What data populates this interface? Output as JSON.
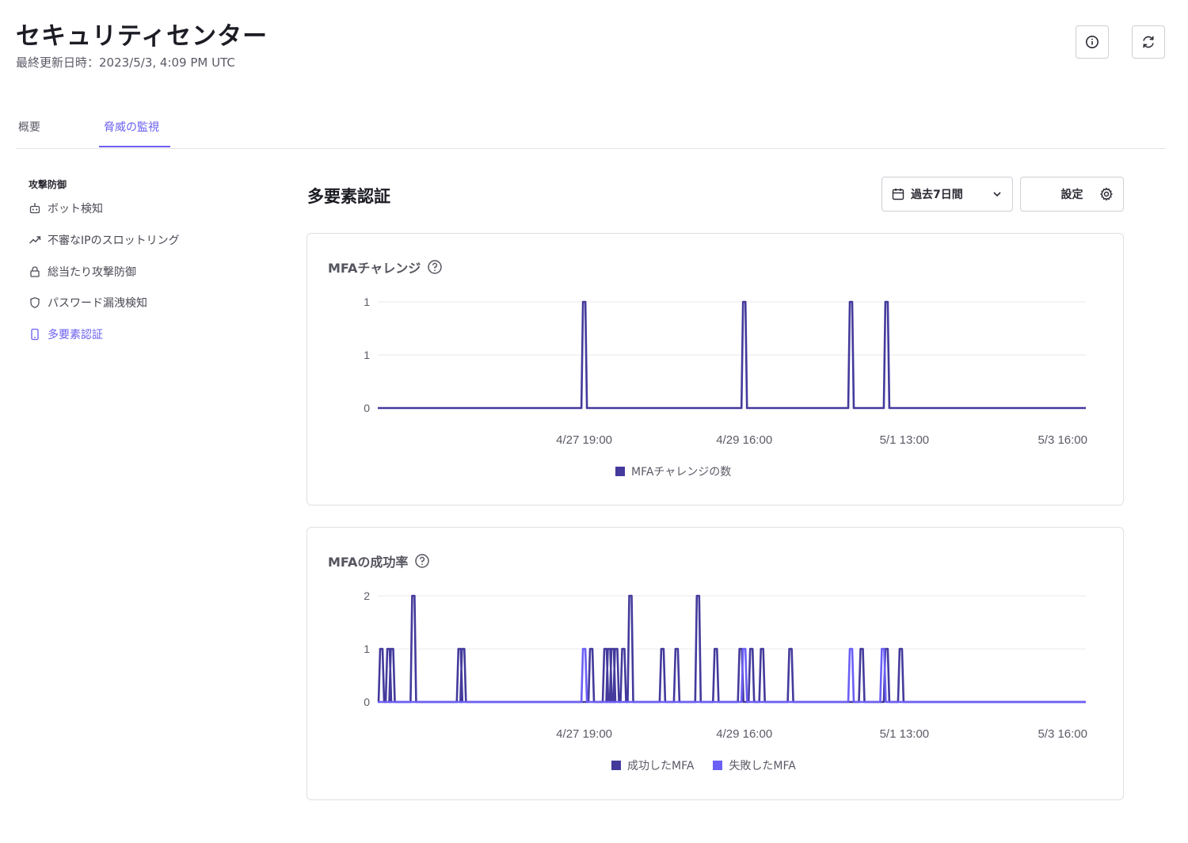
{
  "header": {
    "title": "セキュリティセンター",
    "last_updated": "最終更新日時：2023/5/3, 4:09 PM UTC",
    "info_icon": "info-icon",
    "refresh_icon": "refresh-icon"
  },
  "tabs": [
    {
      "label": "概要",
      "active": false
    },
    {
      "label": "脅威の監視",
      "active": true
    }
  ],
  "sidebar": {
    "section": "攻撃防御",
    "items": [
      {
        "label": "ボット検知",
        "icon": "robot-icon",
        "active": false
      },
      {
        "label": "不審なIPのスロットリング",
        "icon": "trend-icon",
        "active": false
      },
      {
        "label": "総当たり攻撃防御",
        "icon": "lock-icon",
        "active": false
      },
      {
        "label": "パスワード漏洩検知",
        "icon": "shield-icon",
        "active": false
      },
      {
        "label": "多要素認証",
        "icon": "phone-icon",
        "active": true
      }
    ]
  },
  "main": {
    "title": "多要素認証",
    "period": "過去7日間",
    "settings": "設定"
  },
  "colors": {
    "accent": "#6b5ff0",
    "series_dark": "#433a9c",
    "series_light": "#6b5ff6"
  },
  "chart_data": [
    {
      "type": "line",
      "title": "MFAチャレンジ",
      "x_ticks": [
        "4/27 19:00",
        "4/29 16:00",
        "5/1 13:00",
        "5/3 16:00"
      ],
      "y_tick_labels": [
        "1",
        "1",
        "0"
      ],
      "ylim": [
        0,
        1
      ],
      "grid": true,
      "legend_position": "bottom",
      "series": [
        {
          "name": "MFAチャレンジの数",
          "color": "#433a9c",
          "points": [
            [
              "4/27 19:00",
              1
            ],
            [
              "4/29 16:00",
              1
            ],
            [
              "4/30 22:00",
              1
            ],
            [
              "5/1 08:00",
              1
            ]
          ]
        }
      ]
    },
    {
      "type": "line",
      "title": "MFAの成功率",
      "x_ticks": [
        "4/27 19:00",
        "4/29 16:00",
        "5/1 13:00",
        "5/3 16:00"
      ],
      "y_tick_labels": [
        "2",
        "1",
        "0"
      ],
      "ylim": [
        0,
        2
      ],
      "grid": true,
      "legend_position": "bottom",
      "series": [
        {
          "name": "成功したMFA",
          "color": "#433a9c",
          "points": [
            [
              "4/25 10:00",
              1
            ],
            [
              "4/25 12:00",
              1
            ],
            [
              "4/25 13:00",
              1
            ],
            [
              "4/25 19:00",
              2
            ],
            [
              "4/26 08:00",
              1
            ],
            [
              "4/26 09:00",
              1
            ],
            [
              "4/27 21:00",
              1
            ],
            [
              "4/28 01:00",
              1
            ],
            [
              "4/28 02:00",
              1
            ],
            [
              "4/28 03:00",
              1
            ],
            [
              "4/28 04:00",
              1
            ],
            [
              "4/28 06:00",
              1
            ],
            [
              "4/28 08:00",
              2
            ],
            [
              "4/28 17:00",
              1
            ],
            [
              "4/28 21:00",
              1
            ],
            [
              "4/29 03:00",
              2
            ],
            [
              "4/29 08:00",
              1
            ],
            [
              "4/29 15:00",
              1
            ],
            [
              "4/29 18:00",
              1
            ],
            [
              "4/29 21:00",
              1
            ],
            [
              "4/30 05:00",
              1
            ],
            [
              "5/1 01:00",
              1
            ],
            [
              "5/1 08:00",
              1
            ],
            [
              "5/1 12:00",
              1
            ]
          ]
        },
        {
          "name": "失敗したMFA",
          "color": "#6b5ff6",
          "points": [
            [
              "4/27 19:00",
              1
            ],
            [
              "4/29 16:00",
              1
            ],
            [
              "4/30 22:00",
              1
            ],
            [
              "5/1 07:00",
              1
            ]
          ]
        }
      ]
    }
  ]
}
